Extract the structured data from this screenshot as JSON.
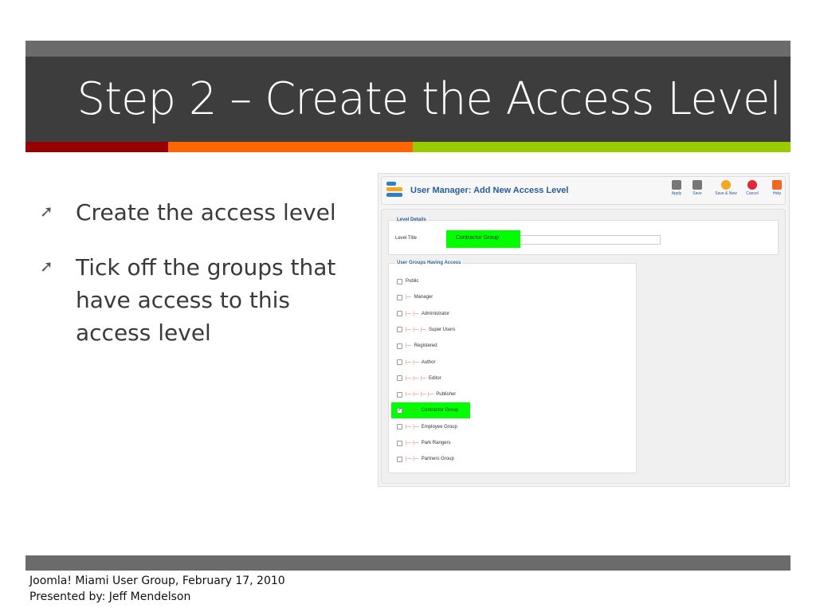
{
  "slide": {
    "title": "Step 2 – Create the Access Level",
    "bullets": [
      "Create the access level",
      "Tick off the groups that have access to this access level"
    ],
    "footer": [
      "Joomla! Miami User Group, February 17, 2010",
      "Presented by: Jeff Mendelson"
    ],
    "colors": {
      "red": "#990000",
      "orange": "#ff6600",
      "green": "#99cc00",
      "highlight": "#00ff00"
    }
  },
  "screenshot": {
    "header": "User Manager: Add New Access Level",
    "toolbar": [
      {
        "label": "Apply",
        "icon": "apply-icon"
      },
      {
        "label": "Save",
        "icon": "save-icon"
      },
      {
        "label": "Save & New",
        "icon": "plus-icon"
      },
      {
        "label": "Cancel",
        "icon": "cancel-icon"
      },
      {
        "label": "Help",
        "icon": "help-icon"
      }
    ],
    "level_details_legend": "Level Details",
    "level_title_label": "Level Title",
    "level_title_value": "Contractor Group",
    "groups_legend": "User Groups Having Access",
    "groups": [
      {
        "name": "Public",
        "depth": 0,
        "checked": false
      },
      {
        "name": "Manager",
        "depth": 1,
        "checked": false
      },
      {
        "name": "Administrator",
        "depth": 2,
        "checked": false
      },
      {
        "name": "Super Users",
        "depth": 3,
        "checked": false
      },
      {
        "name": "Registered",
        "depth": 1,
        "checked": false
      },
      {
        "name": "Author",
        "depth": 2,
        "checked": false
      },
      {
        "name": "Editor",
        "depth": 3,
        "checked": false
      },
      {
        "name": "Publisher",
        "depth": 4,
        "checked": false
      },
      {
        "name": "Contractor Group",
        "depth": 2,
        "checked": true
      },
      {
        "name": "Employee Group",
        "depth": 2,
        "checked": false
      },
      {
        "name": "Park Rangers",
        "depth": 2,
        "checked": false
      },
      {
        "name": "Partners Group",
        "depth": 2,
        "checked": false
      }
    ]
  }
}
